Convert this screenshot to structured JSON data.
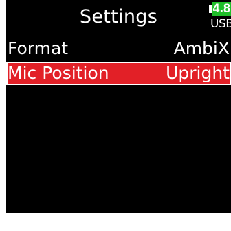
{
  "header": {
    "title": "Settings",
    "battery": {
      "level": "4.8",
      "source": "USB",
      "level_color": "#1fbf2a",
      "icon": "battery-icon"
    }
  },
  "menu": {
    "items": [
      {
        "label": "Format",
        "value": "AmbiX",
        "selected": false
      },
      {
        "label": "Mic Position",
        "value": "Upright",
        "selected": true
      }
    ]
  },
  "colors": {
    "background": "#000000",
    "text": "#ffffff",
    "selection": "#e22027"
  }
}
